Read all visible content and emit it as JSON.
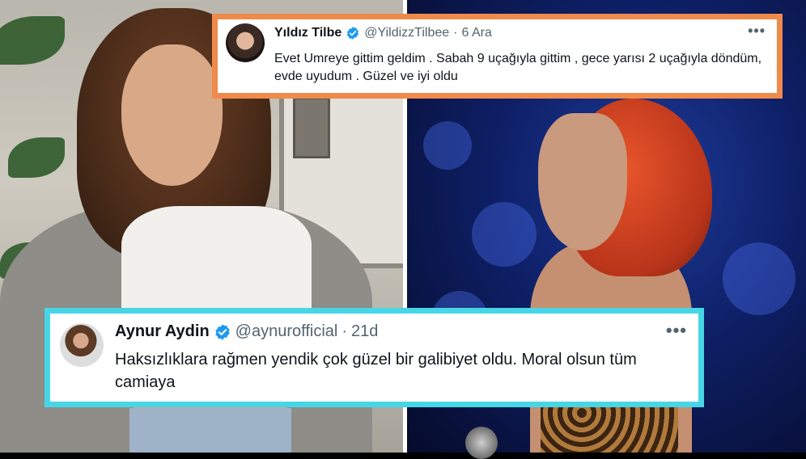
{
  "tweets": [
    {
      "name": "Yıldız Tilbe",
      "handle": "@YildizzTilbee",
      "separator": "·",
      "time": "6 Ara",
      "more": "•••",
      "text": "Evet Umreye gittim geldim . Sabah 9 uçağıyla gittim , gece yarısı 2 uçağıyla döndüm, evde uyudum . Güzel ve iyi oldu",
      "frame_color": "#f08a4b",
      "verified_icon": "verified-badge-icon",
      "verified_color": "#1d9bf0"
    },
    {
      "name": "Aynur Aydin",
      "handle": "@aynurofficial",
      "separator": "·",
      "time": "21d",
      "more": "•••",
      "text": "Haksızlıklara rağmen yendik çok güzel bir galibiyet oldu. Moral olsun tüm camiaya",
      "frame_color": "#47d6e6",
      "verified_icon": "verified-badge-icon",
      "verified_color": "#1d9bf0"
    }
  ]
}
